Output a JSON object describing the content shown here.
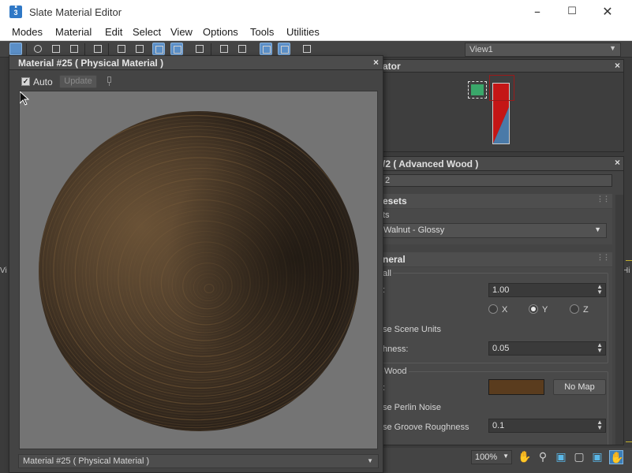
{
  "window": {
    "title": "Slate Material Editor",
    "icon_text": "3"
  },
  "menu": [
    "Modes",
    "Material",
    "Edit",
    "Select",
    "View",
    "Options",
    "Tools",
    "Utilities"
  ],
  "toolbar": {
    "view_dropdown": "View1",
    "icons": [
      "select-arrow-icon",
      "eyedropper-icon",
      "pick-material-icon",
      "put-to-scene-icon",
      "delete-icon",
      "move-children-icon",
      "hide-unused-icon",
      "show-background-icon",
      "show-map-icon",
      "backlight-icon",
      "layout-all-icon",
      "layout-children-icon",
      "material-map-browser-icon",
      "parameter-editor-icon",
      "navigator-icon"
    ]
  },
  "navigator": {
    "title_visible": "ator"
  },
  "wood": {
    "title_visible": "/2  ( Advanced Wood )",
    "name_visible": "2",
    "presets": {
      "header": "esets",
      "label": "ts",
      "value": "Walnut - Glossy"
    },
    "general": {
      "header": "neral",
      "group_all": "all",
      "scale_label": ":",
      "scale_value": "1.00",
      "axis": {
        "x": "X",
        "y": "Y",
        "z": "Z",
        "selected": "Y"
      },
      "use_scene_units": "se Scene Units",
      "roughness_label": "hness:",
      "roughness_value": "0.05"
    },
    "wood_group": {
      "label": "Wood",
      "color_label": ":",
      "color_value": "#5a3c1e",
      "no_map": "No Map",
      "perlin": "se Perlin Noise",
      "groove_label": "se Groove Roughness",
      "groove_value": "0.1"
    }
  },
  "navbar": {
    "zoom": "100%"
  },
  "edge": {
    "left": "Vi",
    "right": "Hi"
  },
  "preview": {
    "title": "Material #25  ( Physical Material )",
    "auto_label": "Auto",
    "auto_checked": true,
    "update_label": "Update",
    "footer_value": "Material #25  ( Physical Material )",
    "background_color": "#747474",
    "wood_color": "#5a4128"
  }
}
